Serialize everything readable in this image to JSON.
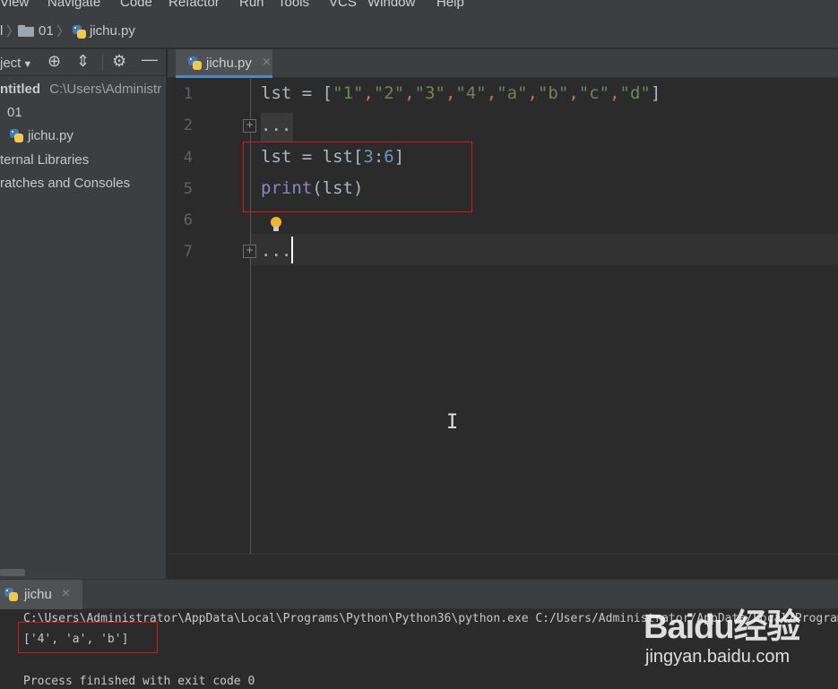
{
  "menubar": {
    "items": [
      "View",
      "Navigate",
      "Code",
      "Refactor",
      "Run",
      "Tools",
      "VCS",
      "Window",
      "Help"
    ]
  },
  "breadcrumb": {
    "root": "l",
    "folder": "01",
    "file": "jichu.py"
  },
  "project_toolbar": {
    "label": "ject"
  },
  "project_tree": {
    "root_name": "ntitled",
    "root_path": "C:\\Users\\Administr",
    "folder": "01",
    "file": "jichu.py",
    "external": "ternal Libraries",
    "scratches": "ratches and Consoles"
  },
  "editor_tab": {
    "label": "jichu.py",
    "close": "×"
  },
  "editor": {
    "line_numbers": [
      "1",
      "2",
      "4",
      "5",
      "6",
      "7"
    ],
    "fold_marker": "+",
    "fold_dots": "...",
    "code": {
      "line1_var": "lst = [",
      "line1_items": [
        "\"1\"",
        "\"2\"",
        "\"3\"",
        "\"4\"",
        "\"a\"",
        "\"b\"",
        "\"c\"",
        "\"d\""
      ],
      "line1_sep": ",",
      "line1_end": "]",
      "line4_a": "lst = lst[",
      "line4_n1": "3",
      "line4_colon": ":",
      "line4_n2": "6",
      "line4_b": "]",
      "line5_fn": "print",
      "line5_arg": "(lst)"
    }
  },
  "run_panel": {
    "tab_label": "jichu",
    "close": "×",
    "command": "C:\\Users\\Administrator\\AppData\\Local\\Programs\\Python\\Python36\\python.exe C:/Users/Administrator/AppData/Local/Programs",
    "output": "['4', 'a', 'b']",
    "exit_message": "Process finished with exit code 0"
  },
  "watermark": {
    "logo": "Baidu经验",
    "url": "jingyan.baidu.com"
  },
  "colors": {
    "highlight_border": "#d11a1a",
    "tab_underline": "#4a88c7",
    "string": "#6a8759",
    "number": "#6897bb"
  }
}
